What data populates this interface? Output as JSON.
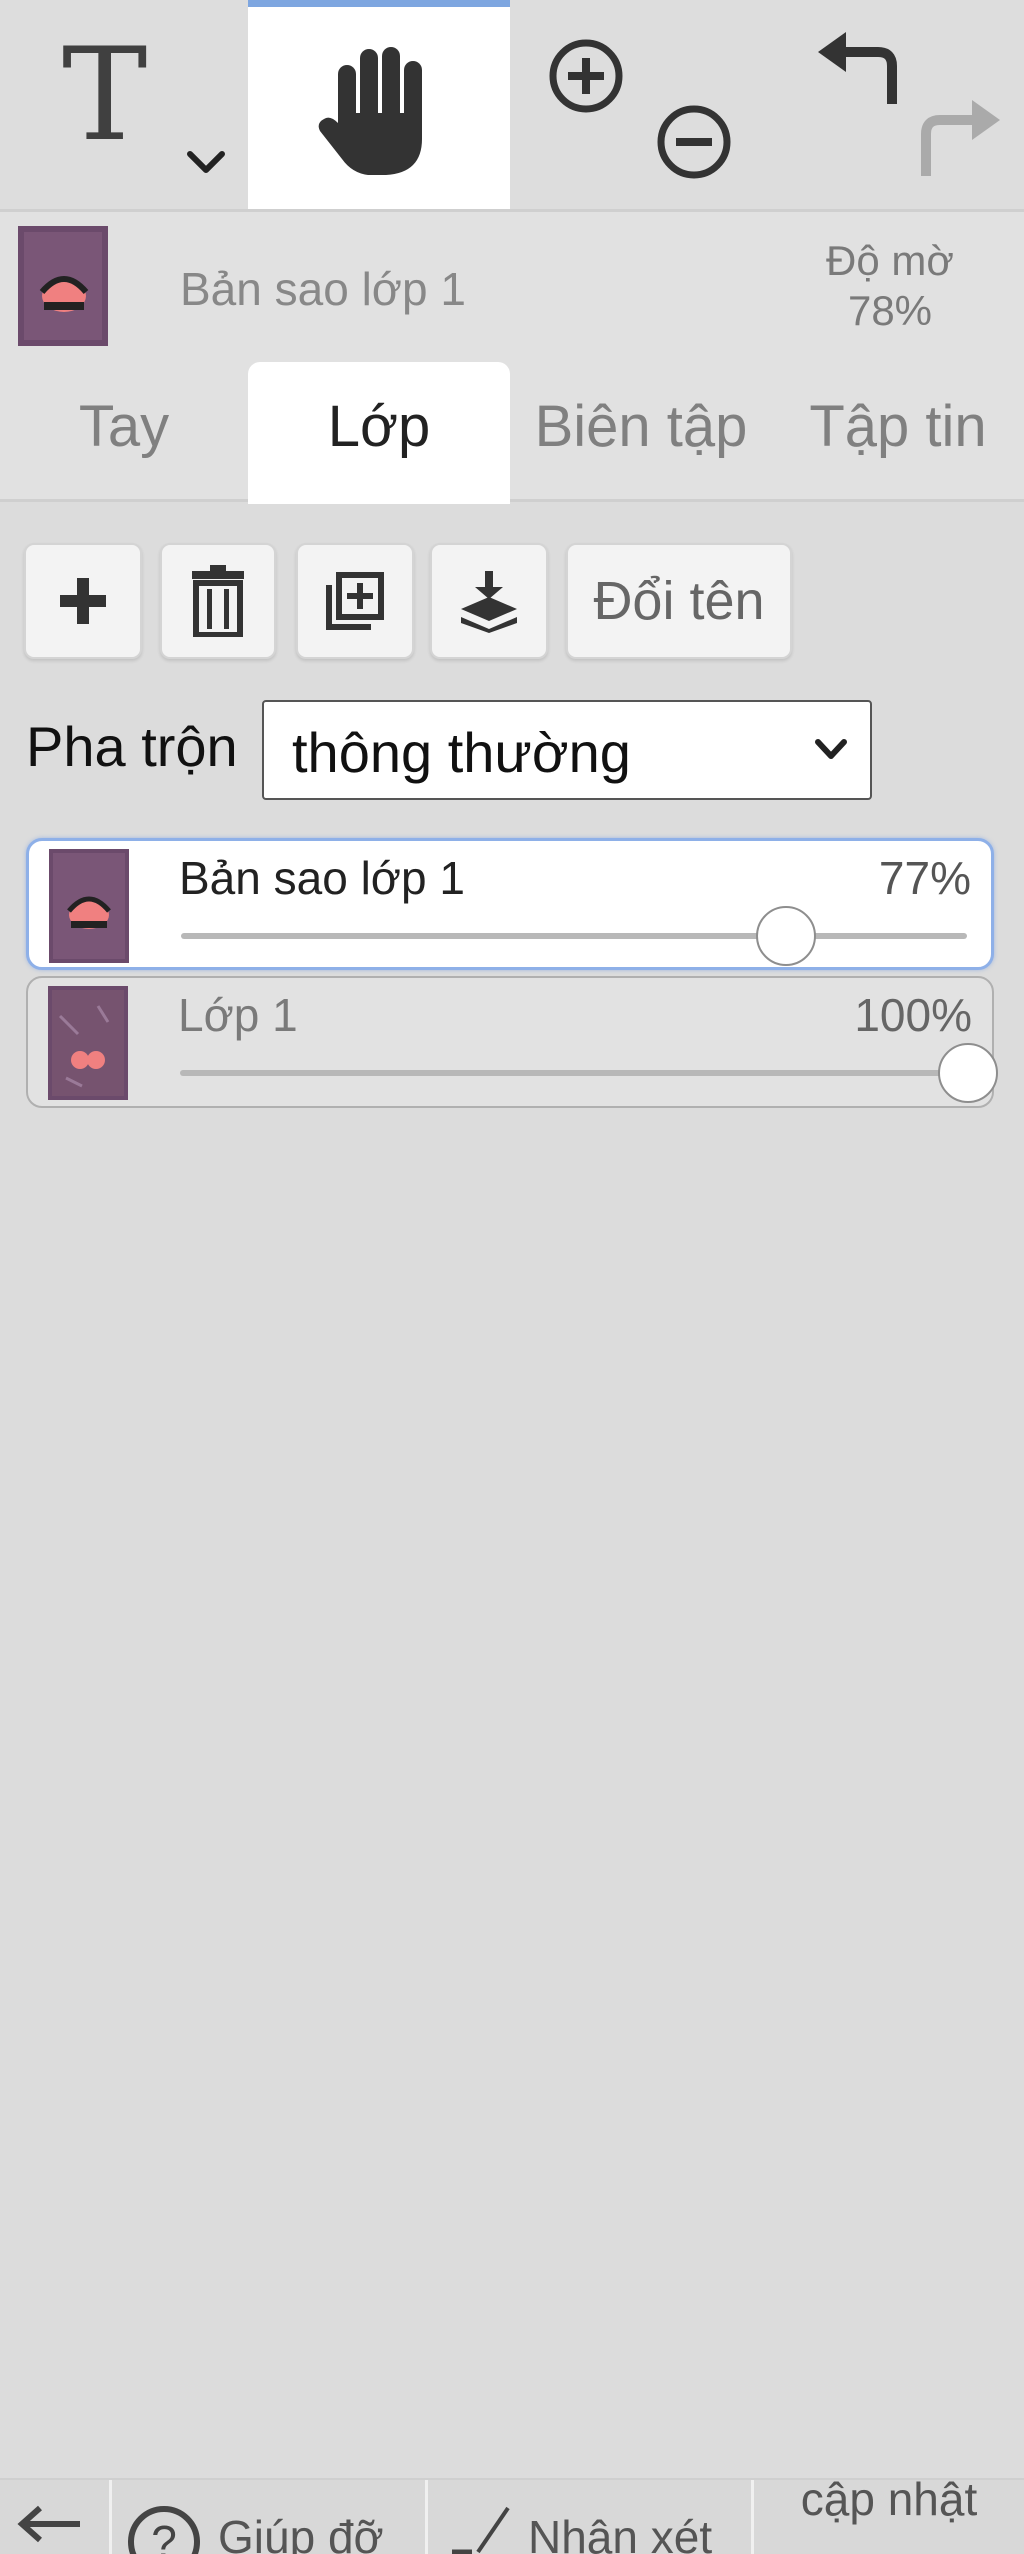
{
  "toolbar": {
    "text_tool_glyph": "T",
    "tools": [
      "text-tool",
      "hand-tool",
      "zoom-in",
      "zoom-out",
      "undo",
      "redo"
    ]
  },
  "infobar": {
    "layer_name": "Bản sao lớp 1",
    "opacity_label": "Độ mờ",
    "opacity_value": "78%"
  },
  "tabs": [
    {
      "label": "Tay"
    },
    {
      "label": "Lớp"
    },
    {
      "label": "Biên tập"
    },
    {
      "label": "Tập tin"
    }
  ],
  "layer_tools": {
    "rename_label": "Đổi tên",
    "icons": [
      "add-icon",
      "trash-icon",
      "duplicate-icon",
      "merge-down-icon"
    ]
  },
  "blend": {
    "label": "Pha trộn",
    "value": "thông thường"
  },
  "layers": [
    {
      "name": "Bản sao lớp 1",
      "opacity_label": "77%",
      "opacity": 0.77
    },
    {
      "name": "Lớp 1",
      "opacity_label": "100%",
      "opacity": 1.0
    }
  ],
  "bottombar": {
    "help_label": "Giúp đỡ",
    "feedback_label": "Nhận xét",
    "update_label": "cập nhật"
  },
  "colors": {
    "accent": "#7ea6e0",
    "background": "#dcdcdc",
    "active_tab": "#ffffff",
    "thumb_purple": "#6b4a6b",
    "thumb_pink": "#f08080"
  }
}
